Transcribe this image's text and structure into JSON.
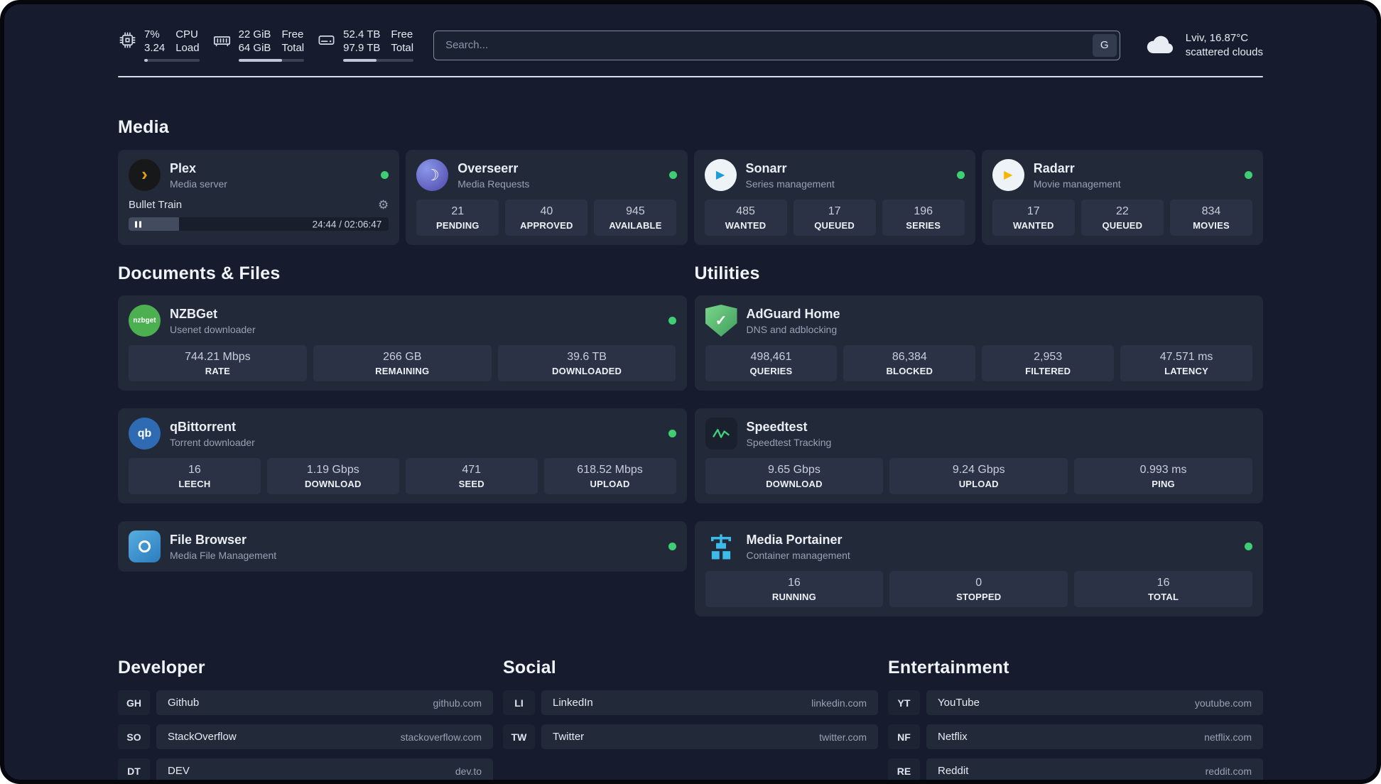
{
  "topbar": {
    "hardware": [
      {
        "icon": "cpu-chip-icon",
        "values": [
          "7%",
          "3.24"
        ],
        "labels": [
          "CPU",
          "Load"
        ],
        "progress_pct": 7
      },
      {
        "icon": "ram-icon",
        "values": [
          "22 GiB",
          "64 GiB"
        ],
        "labels": [
          "Free",
          "Total"
        ],
        "progress_pct": 66
      },
      {
        "icon": "hard-disk-icon",
        "values": [
          "52.4 TB",
          "97.9 TB"
        ],
        "labels": [
          "Free",
          "Total"
        ],
        "progress_pct": 47
      }
    ],
    "search": {
      "placeholder": "Search...",
      "engine_button": "G"
    },
    "weather": {
      "icon": "cloud-icon",
      "location": "Lviv, 16.87°C",
      "condition": "scattered clouds"
    }
  },
  "media": {
    "heading": "Media",
    "cards": [
      {
        "title": "Plex",
        "subtitle": "Media server",
        "status": "online",
        "now_playing": {
          "title": "Bullet Train",
          "time": "24:44 / 02:06:47",
          "progress_pct": 19.5
        }
      },
      {
        "title": "Overseerr",
        "subtitle": "Media Requests",
        "status": "online",
        "stats": [
          {
            "value": "21",
            "label": "PENDING"
          },
          {
            "value": "40",
            "label": "APPROVED"
          },
          {
            "value": "945",
            "label": "AVAILABLE"
          }
        ]
      },
      {
        "title": "Sonarr",
        "subtitle": "Series management",
        "status": "online",
        "stats": [
          {
            "value": "485",
            "label": "WANTED"
          },
          {
            "value": "17",
            "label": "QUEUED"
          },
          {
            "value": "196",
            "label": "SERIES"
          }
        ]
      },
      {
        "title": "Radarr",
        "subtitle": "Movie management",
        "status": "online",
        "stats": [
          {
            "value": "17",
            "label": "WANTED"
          },
          {
            "value": "22",
            "label": "QUEUED"
          },
          {
            "value": "834",
            "label": "MOVIES"
          }
        ]
      }
    ]
  },
  "documents": {
    "heading": "Documents & Files",
    "cards": [
      {
        "title": "NZBGet",
        "subtitle": "Usenet downloader",
        "status": "online",
        "stats": [
          {
            "value": "744.21 Mbps",
            "label": "RATE"
          },
          {
            "value": "266 GB",
            "label": "REMAINING"
          },
          {
            "value": "39.6 TB",
            "label": "DOWNLOADED"
          }
        ]
      },
      {
        "title": "qBittorrent",
        "subtitle": "Torrent downloader",
        "status": "online",
        "stats": [
          {
            "value": "16",
            "label": "LEECH"
          },
          {
            "value": "1.19 Gbps",
            "label": "DOWNLOAD"
          },
          {
            "value": "471",
            "label": "SEED"
          },
          {
            "value": "618.52 Mbps",
            "label": "UPLOAD"
          }
        ]
      },
      {
        "title": "File Browser",
        "subtitle": "Media File Management",
        "status": "online"
      }
    ]
  },
  "utilities": {
    "heading": "Utilities",
    "cards": [
      {
        "title": "AdGuard Home",
        "subtitle": "DNS and adblocking",
        "stats": [
          {
            "value": "498,461",
            "label": "QUERIES"
          },
          {
            "value": "86,384",
            "label": "BLOCKED"
          },
          {
            "value": "2,953",
            "label": "FILTERED"
          },
          {
            "value": "47.571 ms",
            "label": "LATENCY"
          }
        ]
      },
      {
        "title": "Speedtest",
        "subtitle": "Speedtest Tracking",
        "stats": [
          {
            "value": "9.65 Gbps",
            "label": "DOWNLOAD"
          },
          {
            "value": "9.24 Gbps",
            "label": "UPLOAD"
          },
          {
            "value": "0.993 ms",
            "label": "PING"
          }
        ]
      },
      {
        "title": "Media Portainer",
        "subtitle": "Container management",
        "status": "online",
        "stats": [
          {
            "value": "16",
            "label": "RUNNING"
          },
          {
            "value": "0",
            "label": "STOPPED"
          },
          {
            "value": "16",
            "label": "TOTAL"
          }
        ]
      }
    ]
  },
  "bookmarks": [
    {
      "heading": "Developer",
      "links": [
        {
          "abbr": "GH",
          "name": "Github",
          "url": "github.com"
        },
        {
          "abbr": "SO",
          "name": "StackOverflow",
          "url": "stackoverflow.com"
        },
        {
          "abbr": "DT",
          "name": "DEV",
          "url": "dev.to"
        }
      ]
    },
    {
      "heading": "Social",
      "links": [
        {
          "abbr": "LI",
          "name": "LinkedIn",
          "url": "linkedin.com"
        },
        {
          "abbr": "TW",
          "name": "Twitter",
          "url": "twitter.com"
        }
      ]
    },
    {
      "heading": "Entertainment",
      "links": [
        {
          "abbr": "YT",
          "name": "YouTube",
          "url": "youtube.com"
        },
        {
          "abbr": "NF",
          "name": "Netflix",
          "url": "netflix.com"
        },
        {
          "abbr": "RE",
          "name": "Reddit",
          "url": "reddit.com"
        }
      ]
    }
  ],
  "icons": {
    "plex_glyph": "›",
    "overseerr_glyph": "☽",
    "sonarr_glyph": "▶",
    "radarr_glyph": "▶",
    "nzbget_text": "nzbget",
    "qbittorrent_text": "qb",
    "adguard_glyph": "✓",
    "gear_glyph": "⚙"
  },
  "colors": {
    "status_online": "#3ecf72",
    "plex_amber": "#e5a00d",
    "background": "#161c2e",
    "card": "#222938",
    "tile": "#2b3245"
  }
}
